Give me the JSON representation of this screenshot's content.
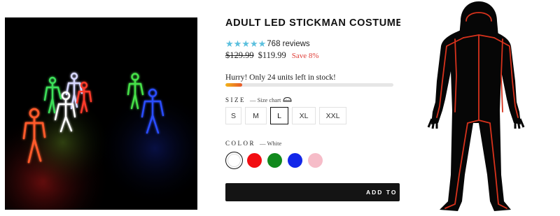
{
  "product": {
    "title": "ADULT LED STICKMAN COSTUME",
    "rating_stars": 5,
    "reviews_text": "768 reviews",
    "old_price": "$129.99",
    "new_price": "$119.99",
    "save_text": "Save 8%"
  },
  "stock": {
    "message": "Hurry! Only 24 units left in stock!",
    "level": 0.1
  },
  "size": {
    "label": "SIZE",
    "chart_text": "— Size chart",
    "chart_icon": "ruler-icon",
    "options": [
      "S",
      "M",
      "L",
      "XL",
      "XXL"
    ],
    "selected": "L"
  },
  "color": {
    "label": "COLOR",
    "selected_text": "— White",
    "swatches": [
      {
        "name": "white",
        "hex": "#ffffff"
      },
      {
        "name": "red",
        "hex": "#f20d12"
      },
      {
        "name": "green",
        "hex": "#11891d"
      },
      {
        "name": "blue",
        "hex": "#1327e9"
      },
      {
        "name": "pink",
        "hex": "#f6bcc8"
      }
    ]
  },
  "cart": {
    "label": "ADD TO"
  },
  "colors": {
    "star": "#5bc0de",
    "save": "#e0403a",
    "button": "#141414"
  }
}
